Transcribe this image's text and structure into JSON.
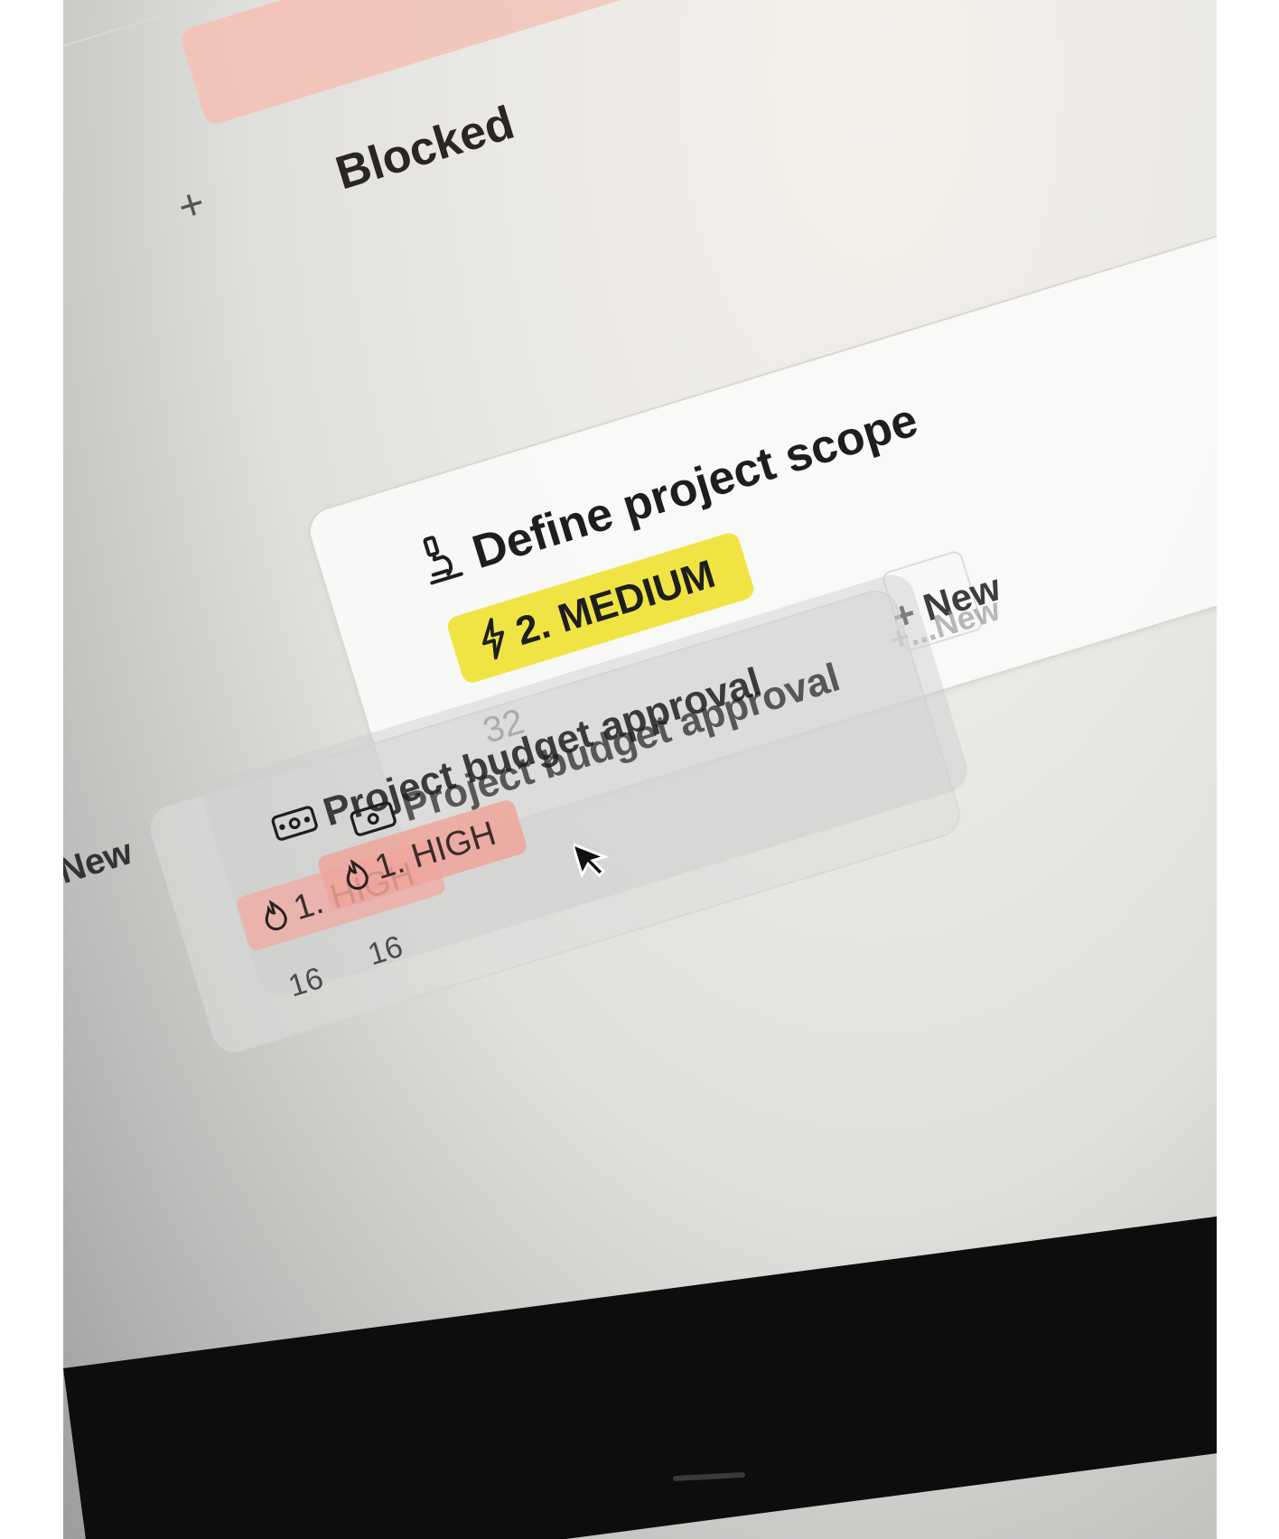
{
  "board": {
    "column": {
      "status_label": "Blocked",
      "add_symbol": "+"
    },
    "cards": [
      {
        "title": "Define project scope",
        "icon": "microscope-icon",
        "priority_label": "2. MEDIUM",
        "priority_icon": "bolt-icon",
        "priority_color": "#f0e444",
        "count": "32"
      }
    ],
    "dragging_card": {
      "title": "Project budget approval",
      "icon": "money-icon",
      "priority_label": "1. HIGH",
      "priority_icon": "flame-icon",
      "priority_color": "#eea59b",
      "count": "16"
    },
    "new_button": {
      "label": "+ New",
      "ghost_label": "+...New"
    },
    "new_left_label": "New"
  },
  "colors": {
    "blocked_pill": "#f2c3b9",
    "medium_pill": "#f0e444",
    "high_pill": "#eea59b"
  }
}
